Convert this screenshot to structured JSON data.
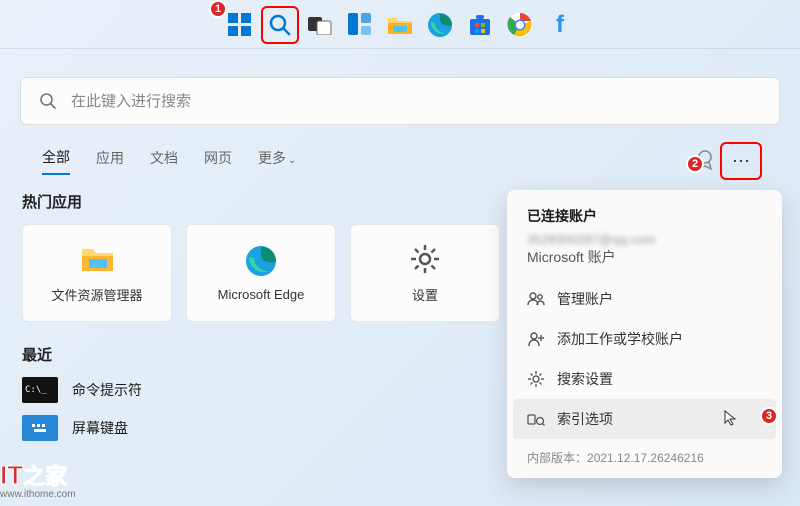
{
  "annotations": {
    "badge1": "1",
    "badge2": "2",
    "badge3": "3"
  },
  "search": {
    "placeholder": "在此键入进行搜索"
  },
  "tabs": {
    "all": "全部",
    "apps": "应用",
    "docs": "文档",
    "web": "网页",
    "more": "更多"
  },
  "sections": {
    "top_apps": "热门应用",
    "recent": "最近"
  },
  "apps": {
    "explorer": "文件资源管理器",
    "edge": "Microsoft Edge",
    "settings": "设置"
  },
  "recent": {
    "cmd": "命令提示符",
    "osk": "屏幕键盘"
  },
  "menu": {
    "header": "已连接账户",
    "email": "3528300287@qq.com",
    "account_type": "Microsoft 账户",
    "manage": "管理账户",
    "add": "添加工作或学校账户",
    "search_settings": "搜索设置",
    "index_options": "索引选项",
    "version_label": "内部版本：",
    "version": "2021.12.17.26246216"
  },
  "watermark": {
    "it": "IT",
    "zhijia": "之家",
    "url": "www.ithome.com"
  }
}
